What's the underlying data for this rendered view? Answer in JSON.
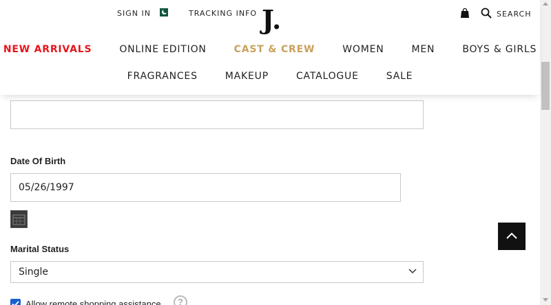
{
  "header": {
    "sign_in": "SIGN IN",
    "tracking": "TRACKING INFO",
    "logo": "J.",
    "search": "SEARCH",
    "nav_row1": [
      {
        "label": "NEW ARRIVALS",
        "color": "#e8141b"
      },
      {
        "label": "ONLINE EDITION",
        "color": "#222222"
      },
      {
        "label": "CAST & CREW",
        "color": "#c9a15c"
      },
      {
        "label": "WOMEN",
        "color": "#222222"
      },
      {
        "label": "MEN",
        "color": "#222222"
      },
      {
        "label": "BOYS & GIRLS",
        "color": "#222222"
      }
    ],
    "nav_row2": [
      {
        "label": "FRAGRANCES"
      },
      {
        "label": "MAKEUP"
      },
      {
        "label": "CATALOGUE"
      },
      {
        "label": "SALE"
      }
    ],
    "icons": [
      "pakistan-flag-icon",
      "shopping-bag-icon",
      "search-icon"
    ]
  },
  "form": {
    "dob_label": "Date Of Birth",
    "dob_value": "05/26/1997",
    "marital_label": "Marital Status",
    "marital_value": "Single",
    "remote_label": "Allow remote shopping assistance",
    "remote_checked": true,
    "help_glyph": "?"
  },
  "colors": {
    "accent_red": "#e8141b",
    "accent_gold": "#c9a15c",
    "checkbox_blue": "#1a5fd0"
  }
}
